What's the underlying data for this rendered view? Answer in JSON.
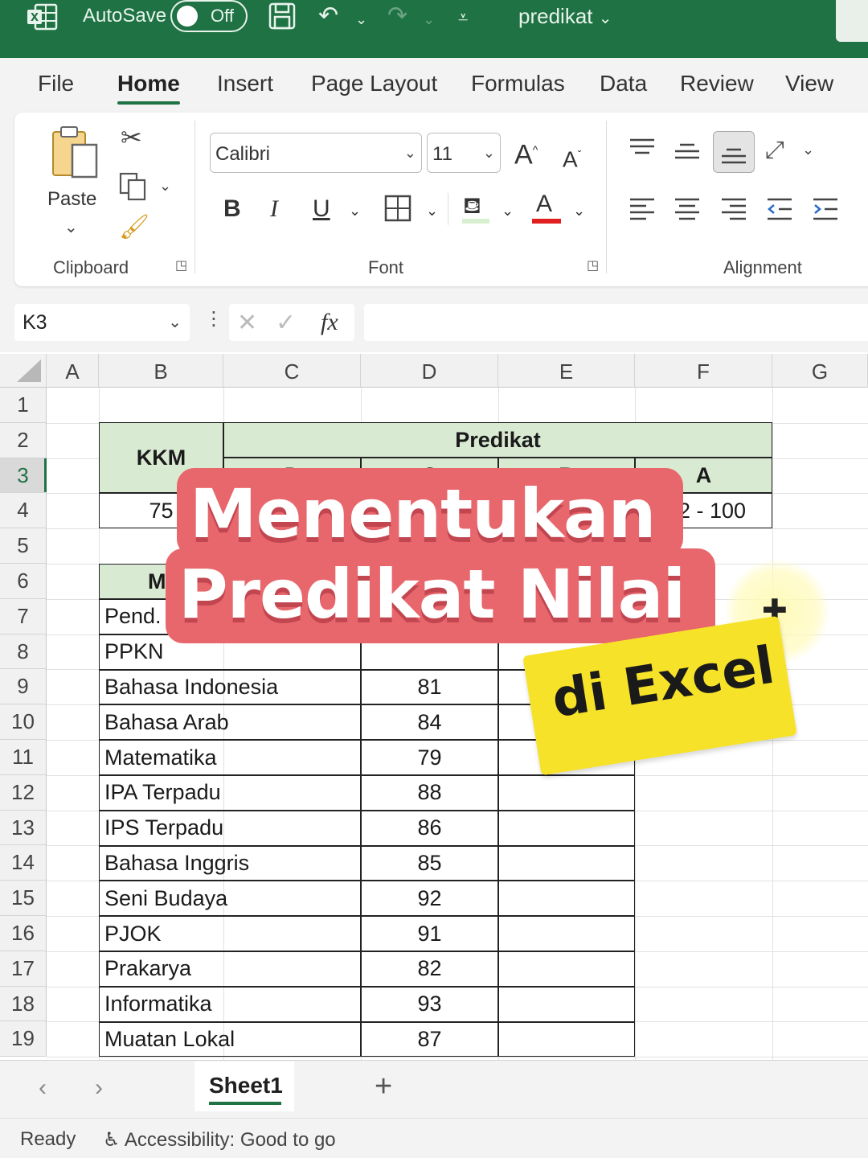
{
  "titlebar": {
    "autosave_label": "AutoSave",
    "autosave_state": "Off",
    "doc_name": "predikat",
    "icons": [
      "excel-logo-icon",
      "save-icon",
      "undo-icon",
      "redo-icon",
      "customize-icon"
    ]
  },
  "ribbon_tabs": [
    "File",
    "Home",
    "Insert",
    "Page Layout",
    "Formulas",
    "Data",
    "Review",
    "View"
  ],
  "active_tab": "Home",
  "clipboard": {
    "paste_label": "Paste",
    "group_label": "Clipboard"
  },
  "font": {
    "font_name": "Calibri",
    "font_size": "11",
    "group_label": "Font",
    "bold": "B",
    "italic": "I",
    "underline": "U",
    "grow": "A",
    "shrink": "A",
    "font_color_glyph": "A"
  },
  "alignment": {
    "group_label": "Alignment"
  },
  "formula_bar": {
    "name_box": "K3",
    "fx_label": "fx",
    "formula": ""
  },
  "grid": {
    "columns": [
      "A",
      "B",
      "C",
      "D",
      "E",
      "F",
      "G"
    ],
    "rows": [
      "1",
      "2",
      "3",
      "4",
      "5",
      "6",
      "7",
      "8",
      "9",
      "10",
      "11",
      "12",
      "13",
      "14",
      "15",
      "16",
      "17",
      "18",
      "19"
    ],
    "selected_row": "3"
  },
  "kkm_table": {
    "kkm_header": "KKM",
    "predikat_header": "Predikat",
    "grades": [
      "D",
      "C",
      "B",
      "A"
    ],
    "kkm_value": "75",
    "a_range": "2 - 100"
  },
  "subjects_table": {
    "header_partial": "M",
    "rows": [
      {
        "subject": "Pend.",
        "score": ""
      },
      {
        "subject": "PPKN",
        "score": ""
      },
      {
        "subject": "Bahasa Indonesia",
        "score": "81"
      },
      {
        "subject": "Bahasa Arab",
        "score": "84"
      },
      {
        "subject": "Matematika",
        "score": "79"
      },
      {
        "subject": "IPA Terpadu",
        "score": "88"
      },
      {
        "subject": "IPS Terpadu",
        "score": "86"
      },
      {
        "subject": "Bahasa Inggris",
        "score": "85"
      },
      {
        "subject": "Seni Budaya",
        "score": "92"
      },
      {
        "subject": "PJOK",
        "score": "91"
      },
      {
        "subject": "Prakarya",
        "score": "82"
      },
      {
        "subject": "Informatika",
        "score": "93"
      },
      {
        "subject": "Muatan Lokal",
        "score": "87"
      }
    ]
  },
  "overlay": {
    "line1": "Menentukan",
    "line2": "Predikat Nilai",
    "sticker": "di Excel"
  },
  "sheets": {
    "active": "Sheet1"
  },
  "status": {
    "ready": "Ready",
    "accessibility": "Accessibility: Good to go"
  },
  "colors": {
    "excel_green": "#1f7244",
    "header_fill": "#d9ead3",
    "overlay_red": "#e8676c",
    "sticker_yellow": "#f7e22a"
  }
}
